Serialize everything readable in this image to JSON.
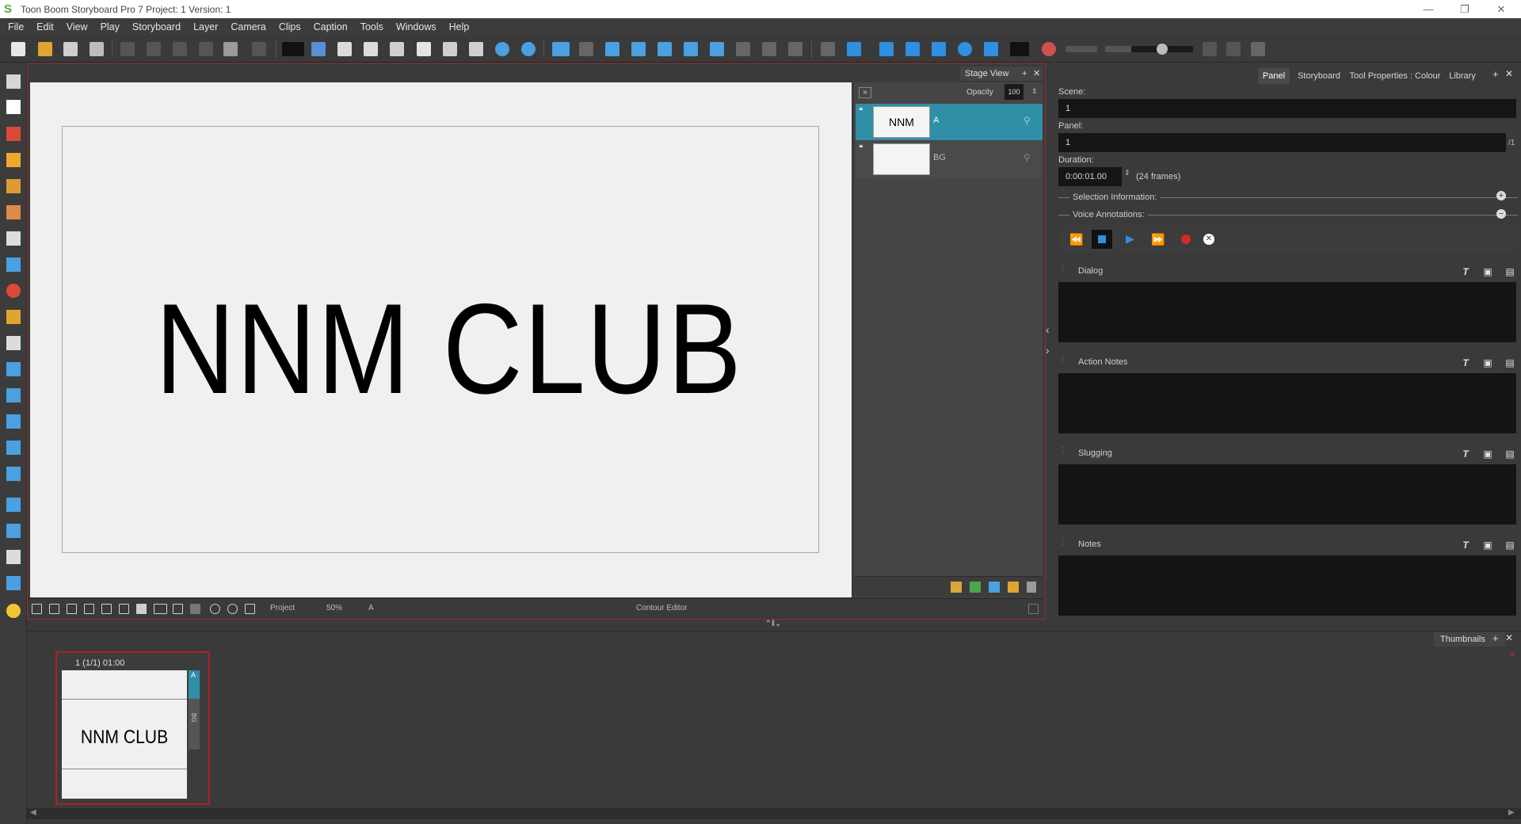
{
  "window": {
    "title": "Toon Boom Storyboard Pro 7 Project: 1 Version: 1",
    "controls": [
      "minimize",
      "restore",
      "close"
    ]
  },
  "menu": [
    "File",
    "Edit",
    "View",
    "Play",
    "Storyboard",
    "Layer",
    "Camera",
    "Clips",
    "Caption",
    "Tools",
    "Windows",
    "Help"
  ],
  "stage": {
    "canvas_text": "NNM CLUB",
    "bottom_bar": {
      "project_label": "Project",
      "zoom": "50%",
      "layer": "A",
      "mode": "Contour Editor"
    }
  },
  "layers_panel": {
    "tab_title": "Stage View",
    "opacity_label": "Opacity",
    "opacity_value": "100",
    "layers": [
      {
        "thumb_text": "NNM CLUB",
        "name": "A",
        "selected": true
      },
      {
        "thumb_text": "",
        "name": "BG",
        "selected": false
      }
    ]
  },
  "right_panel": {
    "tabs": [
      "Panel",
      "Storyboard",
      "Tool Properties : Colour",
      "Library"
    ],
    "active_tab": "Panel",
    "scene_label": "Scene:",
    "scene_value": "1",
    "panel_label": "Panel:",
    "panel_value": "1",
    "panel_total": "/1",
    "duration_label": "Duration:",
    "duration_value": "0:00:01.00",
    "duration_frames": "(24 frames)",
    "selection_info": "Selection Information:",
    "voice_annotations": "Voice Annotations:",
    "sections": [
      "Dialog",
      "Action Notes",
      "Slugging",
      "Notes"
    ]
  },
  "thumbnails": {
    "tab_title": "Thumbnails",
    "panel_header": "1 (1/1) 01:00",
    "panel_text": "NNM CLUB",
    "layer_a": "A",
    "layer_bg": "BG"
  },
  "colors": {
    "accent_selected_layer": "#2e8fa6",
    "frame_red": "#b12121",
    "playback_blue": "#2f8fe0",
    "record_red": "#d92727"
  }
}
